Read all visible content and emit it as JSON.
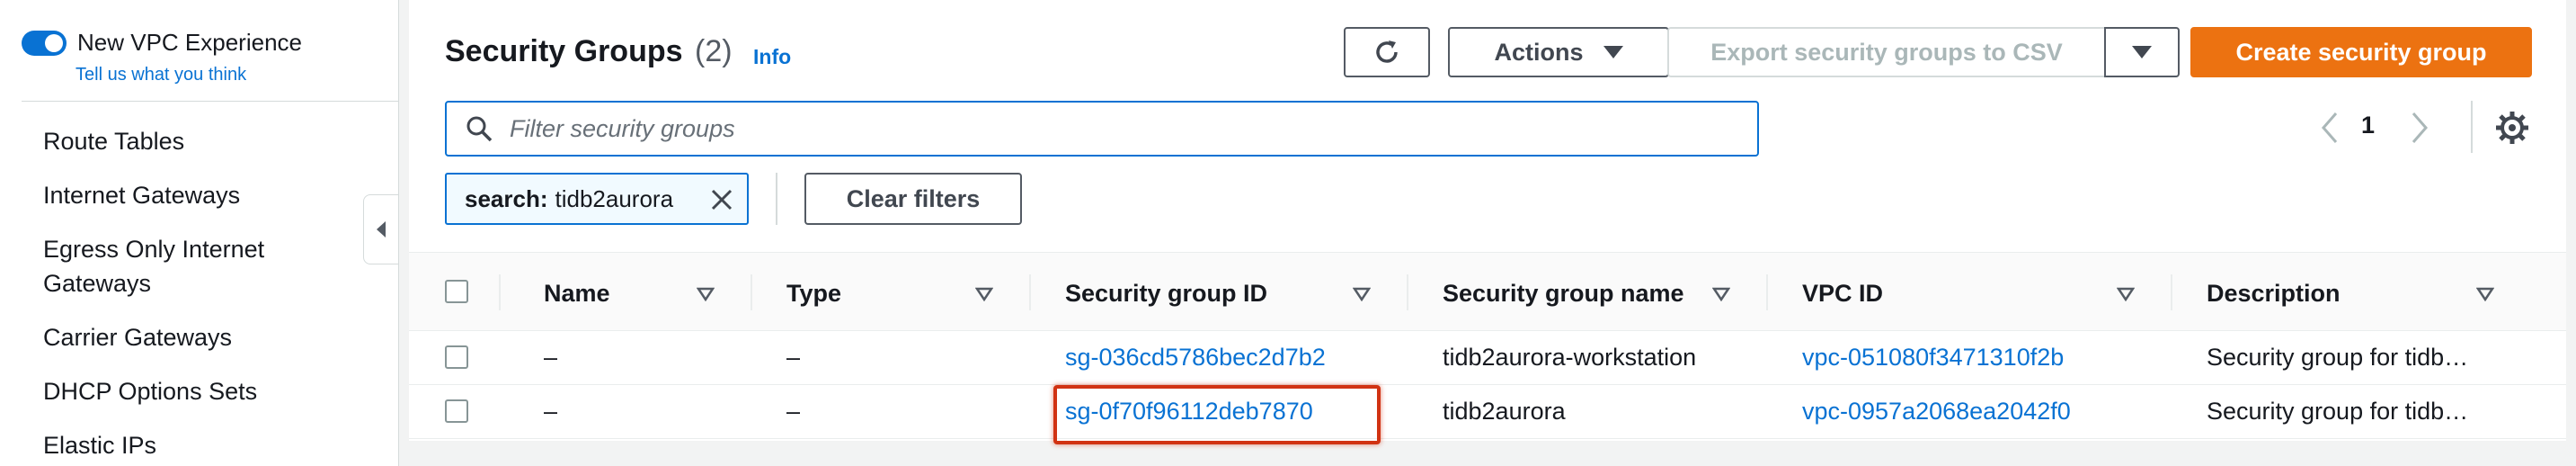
{
  "sidebar": {
    "toggle_label": "New VPC Experience",
    "tell_us": "Tell us what you think",
    "items": [
      {
        "label": "Route Tables"
      },
      {
        "label": "Internet Gateways"
      },
      {
        "label": "Egress Only Internet Gateways"
      },
      {
        "label": "Carrier Gateways"
      },
      {
        "label": "DHCP Options Sets"
      },
      {
        "label": "Elastic IPs"
      }
    ]
  },
  "header": {
    "title": "Security Groups",
    "count": "(2)",
    "info": "Info"
  },
  "toolbar": {
    "actions_label": "Actions",
    "export_label": "Export security groups to CSV",
    "create_label": "Create security group",
    "clear_filters_label": "Clear filters"
  },
  "filter": {
    "placeholder": "Filter security groups",
    "token_key": "search:",
    "token_value": "tidb2aurora"
  },
  "pagination": {
    "current_page": "1"
  },
  "table": {
    "columns": [
      "Name",
      "Type",
      "Security group ID",
      "Security group name",
      "VPC ID",
      "Description"
    ],
    "rows": [
      {
        "name": "–",
        "type": "–",
        "sg_id": "sg-036cd5786bec2d7b2",
        "sg_name": "tidb2aurora-workstation",
        "vpc_id": "vpc-051080f3471310f2b",
        "description": "Security group for tidb…"
      },
      {
        "name": "–",
        "type": "–",
        "sg_id": "sg-0f70f96112deb7870",
        "sg_name": "tidb2aurora",
        "vpc_id": "vpc-0957a2068ea2042f0",
        "description": "Security group for tidb…"
      }
    ]
  },
  "colors": {
    "link": "#0972d3",
    "primary_button": "#ec7211",
    "highlight": "#d13212"
  }
}
